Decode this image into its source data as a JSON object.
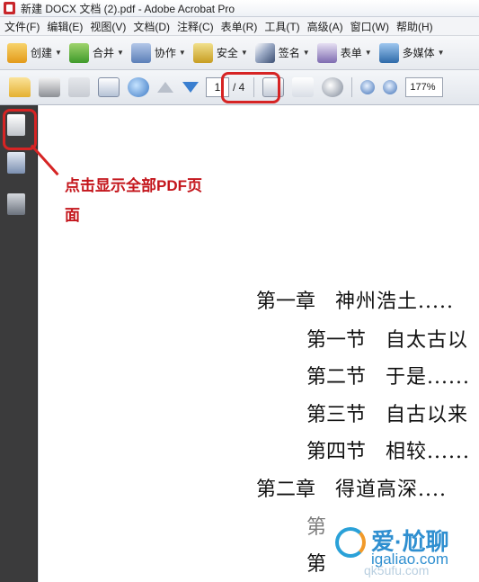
{
  "window": {
    "title": "新建 DOCX 文档 (2).pdf - Adobe Acrobat Pro"
  },
  "menubar": {
    "items": [
      "文件(F)",
      "编辑(E)",
      "视图(V)",
      "文档(D)",
      "注释(C)",
      "表单(R)",
      "工具(T)",
      "高级(A)",
      "窗口(W)",
      "帮助(H)"
    ]
  },
  "toolbar": {
    "create": "创建",
    "merge": "合并",
    "collaborate": "协作",
    "security": "安全",
    "sign": "签名",
    "forms": "表单",
    "multimedia": "多媒体"
  },
  "navigation": {
    "current_page": "1",
    "total_pages": "/ 4",
    "zoom": "177%"
  },
  "annotation": {
    "callout_line1": "点击显示全部PDF页",
    "callout_line2": "面"
  },
  "document": {
    "lines": [
      {
        "label": "第一章",
        "text": "神州浩土....."
      },
      {
        "label": "第一节",
        "text": "自太古以"
      },
      {
        "label": "第二节",
        "text": "于是......"
      },
      {
        "label": "第三节",
        "text": "自古以来"
      },
      {
        "label": "第四节",
        "text": "相较......"
      },
      {
        "label": "第二章",
        "text": "得道高深...."
      },
      {
        "label": "第",
        "text": ""
      },
      {
        "label": "第",
        "text": ""
      }
    ]
  },
  "watermark": {
    "name": "爱·尬聊",
    "url": "igaliao.com",
    "faint": "qk5ufu.com"
  },
  "colors": {
    "highlight": "#d62424",
    "callout_text": "#c4161c",
    "sidebar": "#3b3b3c"
  }
}
